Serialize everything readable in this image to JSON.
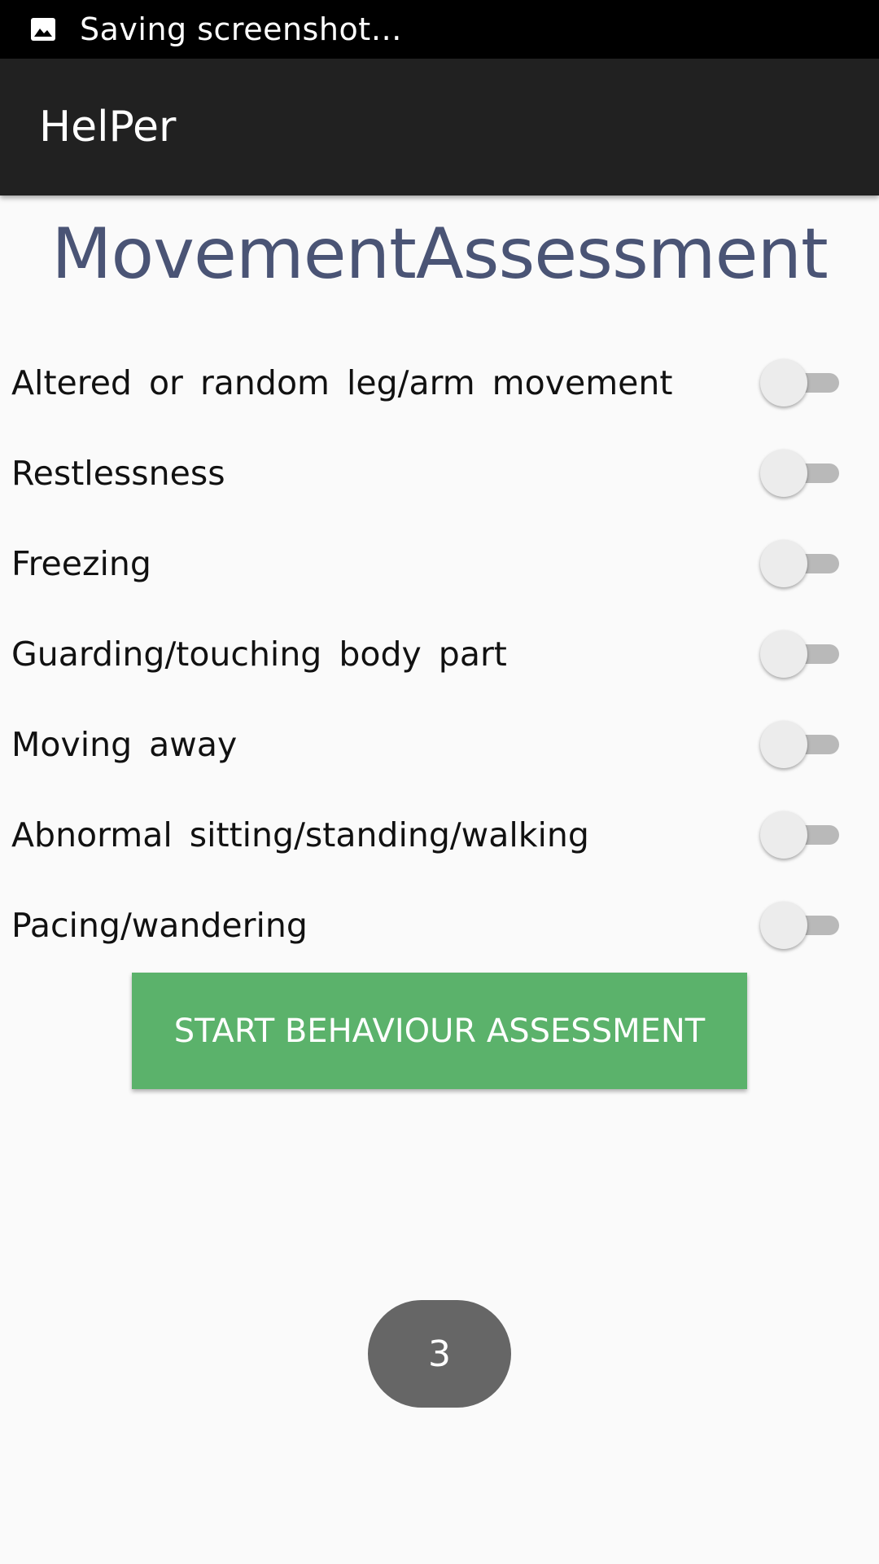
{
  "status_bar": {
    "icon": "image-icon",
    "text": "Saving screenshot…"
  },
  "app_bar": {
    "title": "HelPer"
  },
  "page": {
    "title": "MovementAssessment"
  },
  "items": [
    {
      "label": "Altered or random leg/arm movement",
      "checked": false
    },
    {
      "label": "Restlessness",
      "checked": false
    },
    {
      "label": "Freezing",
      "checked": false
    },
    {
      "label": "Guarding/touching body part",
      "checked": false
    },
    {
      "label": "Moving away",
      "checked": false
    },
    {
      "label": "Abnormal sitting/standing/walking",
      "checked": false
    },
    {
      "label": "Pacing/wandering",
      "checked": false
    }
  ],
  "start_button": {
    "label": "START BEHAVIOUR ASSESSMENT"
  },
  "page_indicator": {
    "value": "3"
  },
  "colors": {
    "status_bar": "#000000",
    "app_bar": "#212121",
    "title_text": "#4a5475",
    "button_green": "#5bb26b",
    "indicator": "#666666",
    "switch_track": "#b9b9b9",
    "switch_thumb": "#ececec"
  }
}
